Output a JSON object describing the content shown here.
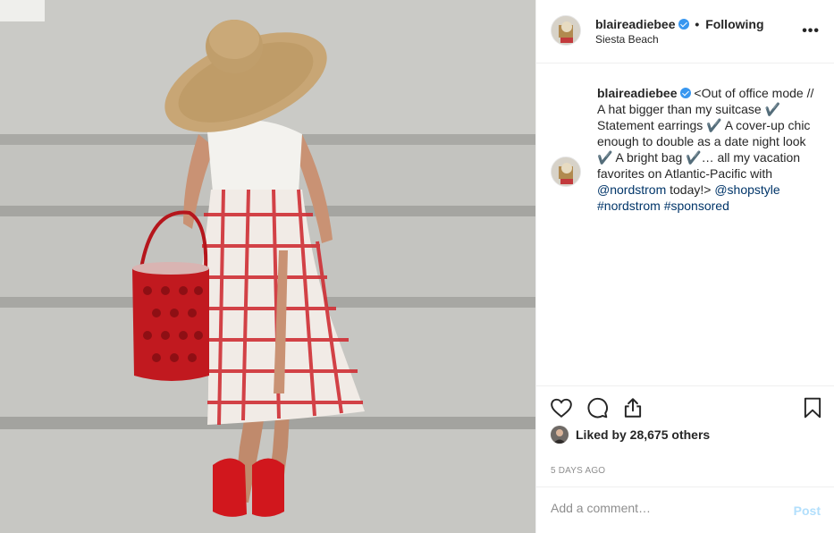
{
  "post": {
    "username": "blaireadiebee",
    "follow_status": "Following",
    "location": "Siesta Beach",
    "more_icon": "ellipsis-icon",
    "caption": {
      "text_1": "<Out of office mode // A hat bigger than my suitcase ✔️ Statement earrings ✔️ A cover-up chic enough to double as a date night look ✔️ A bright bag ✔️… all my vacation favorites on Atlantic-Pacific with ",
      "mention_1": "@nordstrom",
      "text_2": " today!> ",
      "mention_2": "@shopstyle",
      "hashtag_1": "#nordstrom",
      "hashtag_2": "#sponsored"
    },
    "likes_text": "Liked by 28,675 others",
    "timestamp": "5 DAYS AGO",
    "comment_placeholder": "Add a comment…",
    "post_label": "Post",
    "colors": {
      "verified": "#3897f0",
      "link": "#003569",
      "post_disabled": "#b2dffc",
      "meta": "#8e8e8e"
    },
    "action_icons": [
      "heart-icon",
      "comment-icon",
      "share-icon",
      "bookmark-icon"
    ]
  }
}
